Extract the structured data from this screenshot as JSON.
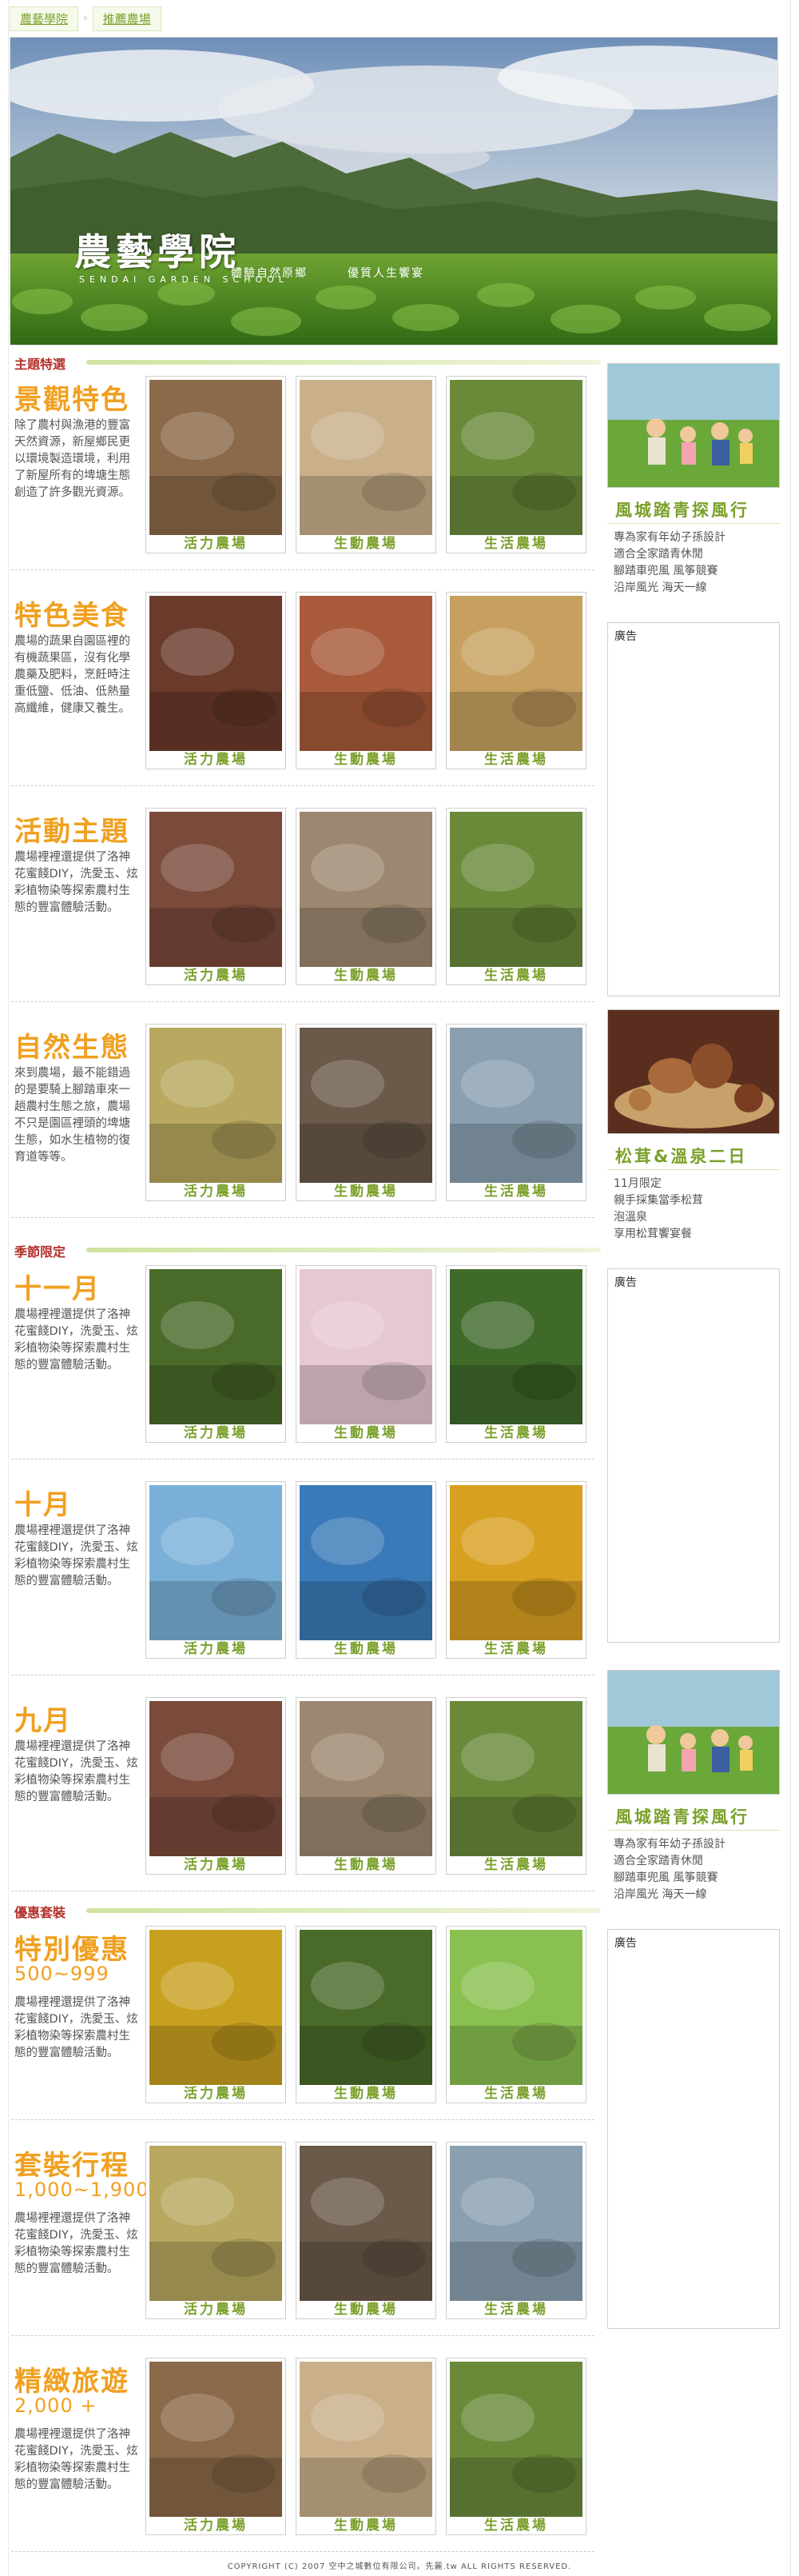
{
  "breadcrumb": {
    "items": [
      "農藝學院",
      "推薦農場"
    ]
  },
  "hero": {
    "title": "農藝學院",
    "subtitle": "SENDAI GARDEN SCHOOL",
    "tag1": "體驗自然原鄉",
    "tag2": "優質人生饗宴"
  },
  "sections": [
    {
      "label": "主題特選"
    },
    {
      "label": "季節限定"
    },
    {
      "label": "優惠套裝"
    }
  ],
  "photo_captions": [
    "活力農場",
    "生動農場",
    "生活農場"
  ],
  "blocks": [
    {
      "title": "景觀特色",
      "desc": "除了農村與漁港的豐富天然資源，新屋鄉民更以環境製造環境，利用了新屋所有的埤塘生態創造了許多觀光資源。"
    },
    {
      "title": "特色美食",
      "desc": "農場的蔬果自園區裡的有機蔬果區，沒有化學農藥及肥料，烹飪時注重低鹽、低油、低熱量高纖維，健康又養生。"
    },
    {
      "title": "活動主題",
      "desc": "農場裡裡還提供了洛神花蜜餞DIY，洗愛玉、炫彩植物染等探索農村生態的豐富體驗活動。"
    },
    {
      "title": "自然生態",
      "desc": "來到農場，最不能錯過的是要騎上腳踏車來一趟農村生態之旅，農場不只是園區裡頭的埤塘生態，如水生植物的復育道等等。"
    },
    {
      "title": "十一月",
      "desc": "農場裡裡還提供了洛神花蜜餞DIY，洗愛玉、炫彩植物染等探索農村生態的豐富體驗活動。"
    },
    {
      "title": "十月",
      "desc": "農場裡裡還提供了洛神花蜜餞DIY，洗愛玉、炫彩植物染等探索農村生態的豐富體驗活動。"
    },
    {
      "title": "九月",
      "desc": "農場裡裡還提供了洛神花蜜餞DIY，洗愛玉、炫彩植物染等探索農村生態的豐富體驗活動。"
    },
    {
      "title": "特別優惠",
      "price": "500~999",
      "desc": "農場裡裡還提供了洛神花蜜餞DIY，洗愛玉、炫彩植物染等探索農村生態的豐富體驗活動。"
    },
    {
      "title": "套裝行程",
      "price": "1,000~1,900",
      "desc": "農場裡裡還提供了洛神花蜜餞DIY，洗愛玉、炫彩植物染等探索農村生態的豐富體驗活動。"
    },
    {
      "title": "精緻旅遊",
      "price": "2,000 +",
      "desc": "農場裡裡還提供了洛神花蜜餞DIY，洗愛玉、炫彩植物染等探索農村生態的豐富體驗活動。"
    }
  ],
  "sidebar": {
    "promo1": {
      "title": "風城踏青探風行",
      "lines": [
        "專為家有年幼子孫設計",
        "適合全家踏青休閒",
        "腳踏車兜風 風筝競賽",
        "沿岸風光 海天一線"
      ]
    },
    "promo2": {
      "title": "松茸&溫泉二日",
      "lines": [
        "11月限定",
        "親手採集當季松茸",
        "泡溫泉",
        "享用松茸饗宴餐"
      ]
    },
    "promo3": {
      "title": "風城踏青探風行",
      "lines": [
        "專為家有年幼子孫設計",
        "適合全家踏青休閒",
        "腳踏車兜風 風筝競賽",
        "沿岸風光 海天一線"
      ]
    },
    "ad_label": "廣告"
  },
  "footer": {
    "text": "COPYRIGHT (C) 2007 空中之城數位有限公司。先麗.tw ALL RIGHTS RESERVED."
  },
  "colors": {
    "accent_green": "#7aa02a",
    "title_orange": "#f0a020",
    "section_red": "#b5312b"
  }
}
